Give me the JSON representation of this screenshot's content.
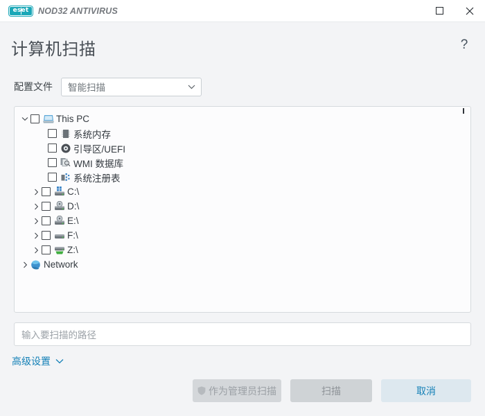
{
  "titlebar": {
    "logo_text": "eset",
    "product_name": "NOD32 ANTIVIRUS",
    "maximize_label": "",
    "close_label": ""
  },
  "header": {
    "title": "计算机扫描",
    "help_label": "?"
  },
  "profile": {
    "label": "配置文件",
    "selected": "智能扫描",
    "options": [
      "智能扫描"
    ]
  },
  "tree": {
    "nodes": [
      {
        "label": "This PC",
        "icon": "computer-icon",
        "indent": 0,
        "twisty": "expanded",
        "checkbox": true
      },
      {
        "label": "系统内存",
        "icon": "memory-icon",
        "indent": 1,
        "twisty": "none",
        "checkbox": true
      },
      {
        "label": "引导区/UEFI",
        "icon": "boot-sector-icon",
        "indent": 1,
        "twisty": "none",
        "checkbox": true
      },
      {
        "label": "WMI 数据库",
        "icon": "wmi-database-icon",
        "indent": 1,
        "twisty": "none",
        "checkbox": true
      },
      {
        "label": "系统注册表",
        "icon": "registry-icon",
        "indent": 1,
        "twisty": "none",
        "checkbox": true
      },
      {
        "label": "C:\\",
        "icon": "system-drive-icon",
        "indent": 2,
        "twisty": "collapsed",
        "checkbox": true
      },
      {
        "label": "D:\\",
        "icon": "optical-drive-icon",
        "indent": 2,
        "twisty": "collapsed",
        "checkbox": true
      },
      {
        "label": "E:\\",
        "icon": "optical-drive-icon",
        "indent": 2,
        "twisty": "collapsed",
        "checkbox": true
      },
      {
        "label": "F:\\",
        "icon": "hard-drive-icon",
        "indent": 2,
        "twisty": "collapsed",
        "checkbox": true
      },
      {
        "label": "Z:\\",
        "icon": "network-drive-icon",
        "indent": 2,
        "twisty": "collapsed",
        "checkbox": true
      },
      {
        "label": "Network",
        "icon": "network-globe-icon",
        "indent": 0,
        "twisty": "collapsed",
        "checkbox": false
      }
    ]
  },
  "path_input": {
    "value": "",
    "placeholder": "输入要扫描的路径"
  },
  "advanced": {
    "label": "高级设置"
  },
  "footer": {
    "scan_as_admin_label": "作为管理员扫描",
    "scan_label": "扫描",
    "cancel_label": "取消"
  },
  "colors": {
    "brand_teal": "#1aa7b7",
    "accent_blue": "#1581b7",
    "cancel_bg": "#dde8ef",
    "window_bg": "#f3f4f6",
    "panel_bg": "#fcfcfd"
  }
}
